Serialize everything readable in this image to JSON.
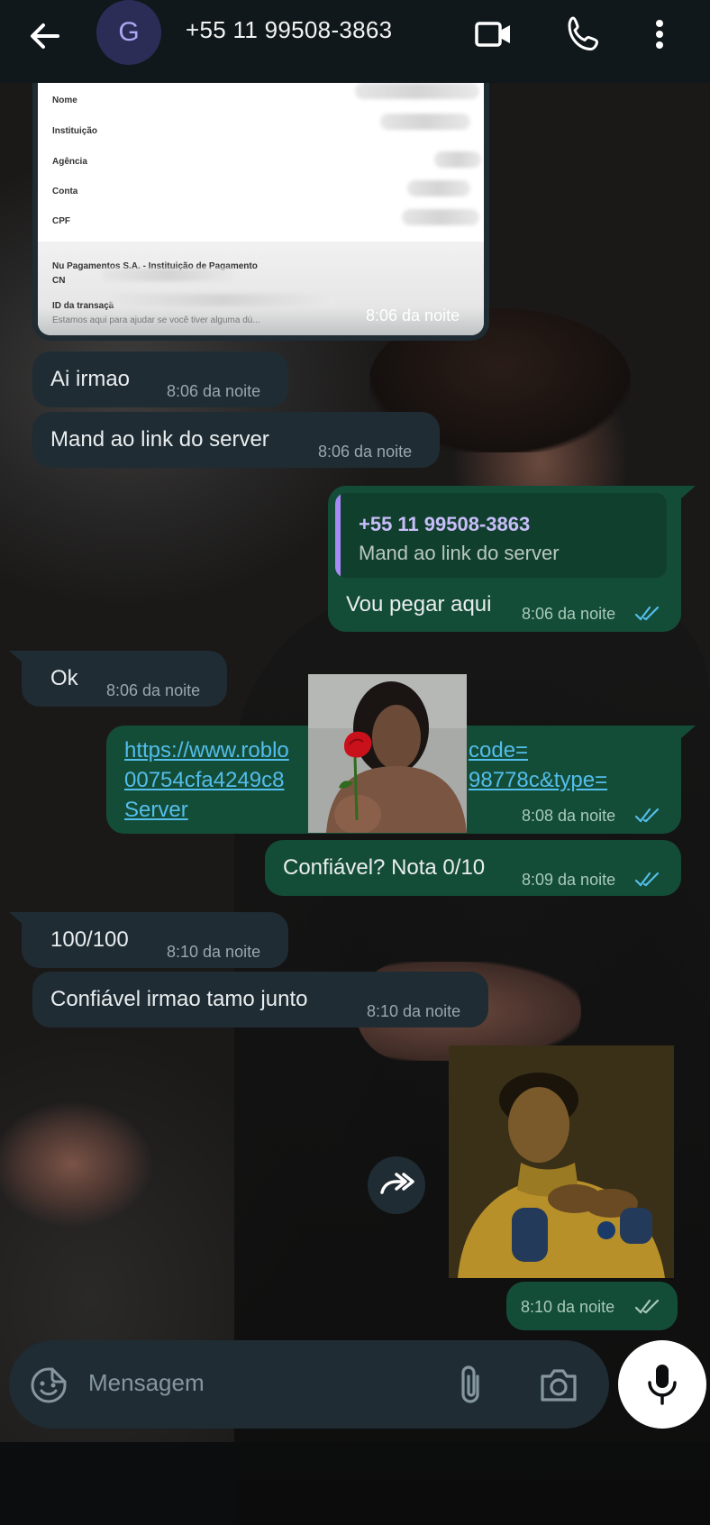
{
  "header": {
    "avatar_letter": "G",
    "contact_name": "+55 11 99508-3863"
  },
  "receipt": {
    "fields": [
      "Nome",
      "Instituição",
      "Agência",
      "Conta",
      "CPF"
    ],
    "footer_title": "Nu Pagamentos S.A. - Instituição de Pagamento",
    "footer_cnpj": "CN",
    "footer_id": "ID da transaçã",
    "footer_help": "Estamos aqui para ajudar se você tiver alguma dú...",
    "time": "8:06 da noite"
  },
  "messages": [
    {
      "dir": "in",
      "text": "Ai irmao",
      "time": "8:06 da noite"
    },
    {
      "dir": "in",
      "text": "Mand ao link do server",
      "time": "8:06 da noite"
    },
    {
      "dir": "out",
      "quote_author": "+55 11 99508-3863",
      "quote_text": "Mand ao link do server",
      "text": "Vou pegar aqui",
      "time": "8:06 da noite"
    },
    {
      "dir": "in",
      "text": "Ok",
      "time": "8:06 da noite"
    },
    {
      "dir": "out",
      "link_lines": [
        "https://www.roblo",
        "code=",
        "00754cfa4249c8",
        "98778c&type=",
        "Server"
      ],
      "time": "8:08 da noite"
    },
    {
      "dir": "out",
      "text": "Confiável? Nota 0/10",
      "time": "8:09 da noite"
    },
    {
      "dir": "in",
      "text": "100/100",
      "time": "8:10 da noite"
    },
    {
      "dir": "in",
      "text": "Confiável irmao tamo junto",
      "time": "8:10 da noite"
    },
    {
      "dir": "out",
      "image": "forwarded-photo",
      "time": "8:10 da noite"
    }
  ],
  "composer": {
    "placeholder": "Mensagem"
  },
  "colors": {
    "incoming_bubble": "#1f2c33",
    "outgoing_bubble": "#144d37",
    "read_ticks": "#53bdeb",
    "link": "#53bdeb",
    "quote_bar": "#a68af5"
  }
}
